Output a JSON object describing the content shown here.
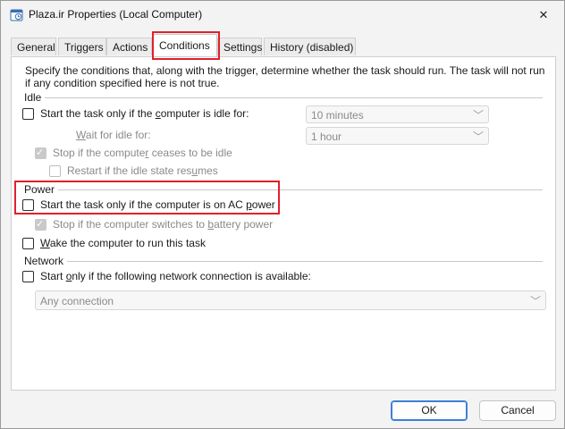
{
  "window": {
    "title": "Plaza.ir Properties (Local Computer)",
    "close_glyph": "✕"
  },
  "tabs": [
    {
      "label": "General"
    },
    {
      "label": "Triggers"
    },
    {
      "label": "Actions"
    },
    {
      "label": "Conditions",
      "active": true
    },
    {
      "label": "Settings"
    },
    {
      "label": "History (disabled)"
    }
  ],
  "description": "Specify the conditions that, along with the trigger, determine whether the task should run.  The task will not run  if any condition specified here is not true.",
  "idle": {
    "group_label": "Idle",
    "start_if_idle": {
      "pre": "Start the task only if the ",
      "acc": "c",
      "post": "omputer is idle for:",
      "checked": false
    },
    "idle_duration": {
      "value": "10 minutes"
    },
    "wait_label": {
      "pre": "",
      "acc": "W",
      "post": "ait for idle for:"
    },
    "wait_duration": {
      "value": "1 hour"
    },
    "stop_if_ceases": {
      "pre": "Stop if the compute",
      "acc": "r",
      "post": " ceases to be idle",
      "checked": true
    },
    "restart_if_resumes": {
      "pre": "Restart if the idle state res",
      "acc": "u",
      "post": "mes",
      "checked": false
    }
  },
  "power": {
    "group_label": "Power",
    "start_on_ac": {
      "pre": "Start the task only if the computer is on AC ",
      "acc": "p",
      "post": "ower",
      "checked": false
    },
    "stop_on_battery": {
      "pre": "Stop if the computer switches to ",
      "acc": "b",
      "post": "attery power",
      "checked": true
    },
    "wake_to_run": {
      "pre": "",
      "acc": "W",
      "post": "ake the computer to run this task",
      "checked": false
    }
  },
  "network": {
    "group_label": "Network",
    "start_if_network": {
      "pre": "Start ",
      "acc": "o",
      "post": "nly if the following network connection is available:",
      "checked": false
    },
    "connection": {
      "value": "Any connection"
    }
  },
  "buttons": {
    "ok": "OK",
    "cancel": "Cancel"
  },
  "colors": {
    "highlight_box": "#e0202c",
    "primary_button_border": "#3e7fd6"
  }
}
